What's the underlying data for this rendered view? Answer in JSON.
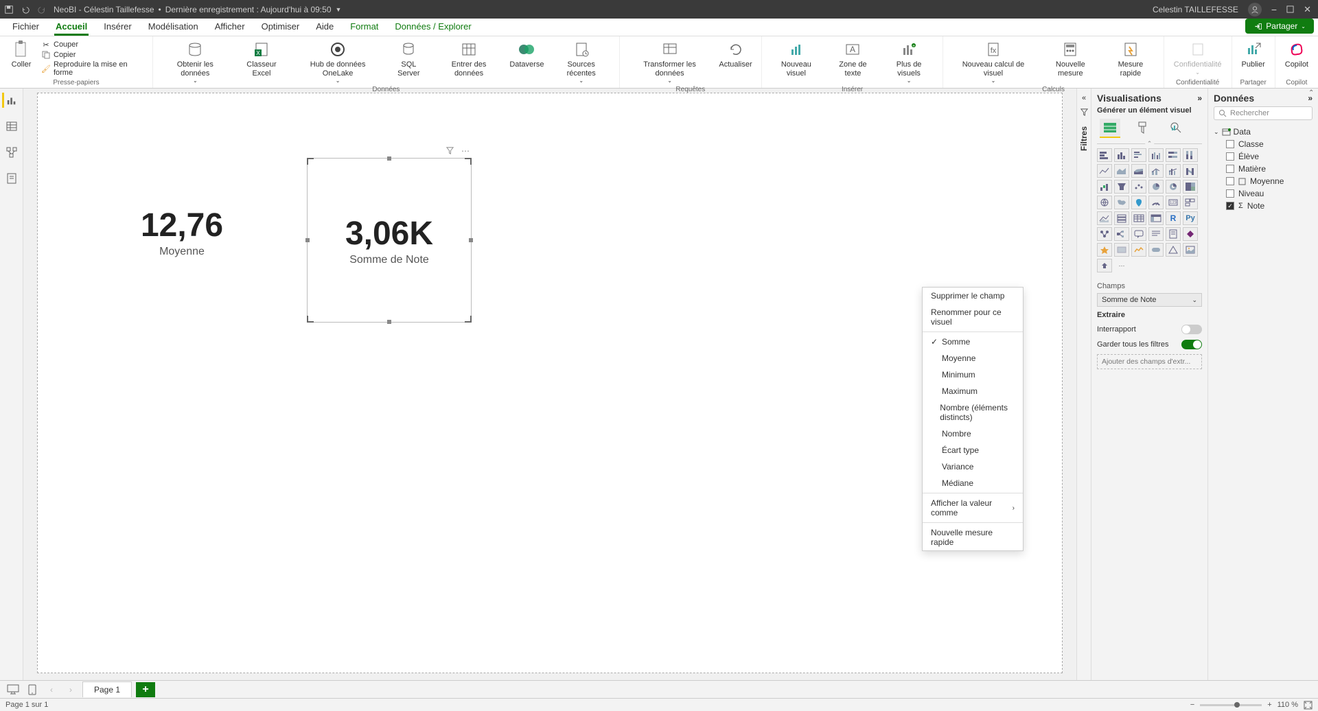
{
  "titlebar": {
    "doc": "NeoBI - Célestin Taillefesse",
    "saved": "Dernière enregistrement : Aujourd'hui à 09:50",
    "user": "Celestin TAILLEFESSE"
  },
  "tabs": {
    "fichier": "Fichier",
    "accueil": "Accueil",
    "inserer": "Insérer",
    "modelisation": "Modélisation",
    "afficher": "Afficher",
    "optimiser": "Optimiser",
    "aide": "Aide",
    "format": "Format",
    "donnees": "Données / Explorer",
    "share": "Partager"
  },
  "ribbon": {
    "clipboard_group": "Presse-papiers",
    "paste": "Coller",
    "cut": "Couper",
    "copy": "Copier",
    "format_painter": "Reproduire la mise en forme",
    "data_group": "Données",
    "get_data": "Obtenir les données",
    "excel": "Classeur Excel",
    "onelake": "Hub de données OneLake",
    "sql": "SQL Server",
    "enter_data": "Entrer des données",
    "dataverse": "Dataverse",
    "recent": "Sources récentes",
    "queries_group": "Requêtes",
    "transform": "Transformer les données",
    "refresh": "Actualiser",
    "insert_group": "Insérer",
    "new_visual": "Nouveau visuel",
    "textbox": "Zone de texte",
    "more_visuals": "Plus de visuels",
    "calc_group": "Calculs",
    "new_calc": "Nouveau calcul de visuel",
    "new_measure": "Nouvelle mesure",
    "quick_measure": "Mesure rapide",
    "sensitivity_group": "Confidentialité",
    "sensitivity": "Confidentialité",
    "share_group": "Partager",
    "publish": "Publier",
    "copilot_group": "Copilot",
    "copilot": "Copilot"
  },
  "canvas": {
    "card1_value": "12,76",
    "card1_label": "Moyenne",
    "card2_value": "3,06K",
    "card2_label": "Somme de Note"
  },
  "filters_label": "Filtres",
  "viz": {
    "title": "Visualisations",
    "subtitle": "Générer un élément visuel",
    "fields_label": "Champs",
    "field_value": "Somme de Note",
    "drill_label": "Extraire",
    "cross_report": "Interrapport",
    "keep_filters": "Garder tous les filtres",
    "add_drill": "Ajouter des champs d'extr..."
  },
  "data": {
    "title": "Données",
    "search_placeholder": "Rechercher",
    "table": "Data",
    "fields": {
      "classe": "Classe",
      "eleve": "Élève",
      "matiere": "Matière",
      "moyenne": "Moyenne",
      "niveau": "Niveau",
      "note": "Note"
    }
  },
  "ctx": {
    "remove": "Supprimer le champ",
    "rename": "Renommer pour ce visuel",
    "sum": "Somme",
    "avg": "Moyenne",
    "min": "Minimum",
    "max": "Maximum",
    "dcount": "Nombre (éléments distincts)",
    "count": "Nombre",
    "stdev": "Écart type",
    "var": "Variance",
    "median": "Médiane",
    "show_as": "Afficher la valeur comme",
    "quick": "Nouvelle mesure rapide"
  },
  "pages": {
    "page1": "Page 1"
  },
  "status": {
    "page_info": "Page 1 sur 1",
    "zoom": "110 %"
  }
}
